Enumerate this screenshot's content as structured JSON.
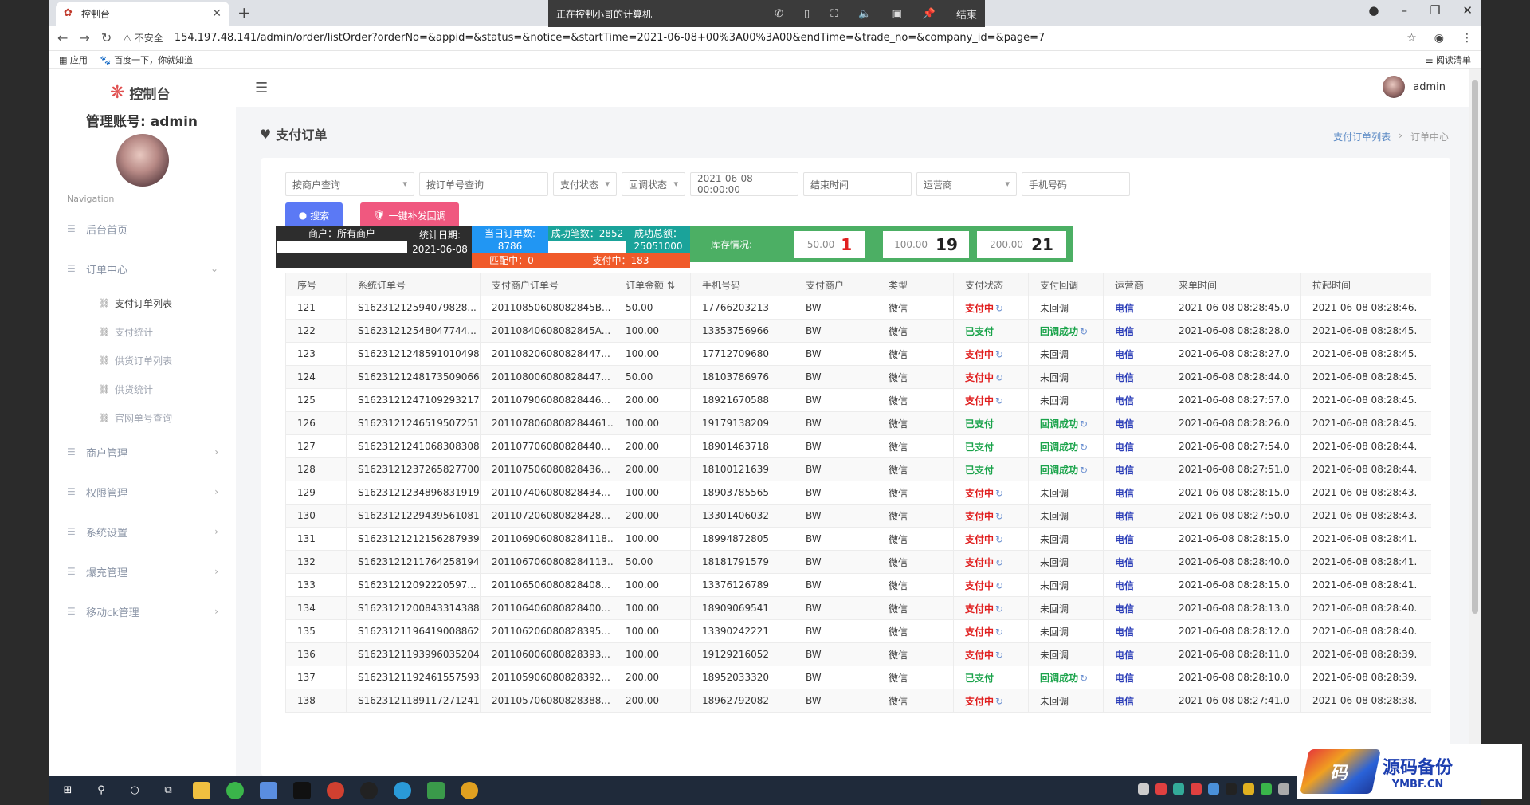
{
  "browser": {
    "tab_title": "控制台",
    "url": "154.197.48.141/admin/order/listOrder?orderNo=&appid=&status=&notice=&startTime=2021-06-08+00%3A00%3A00&endTime=&trade_no=&company_id=&page=7",
    "security_label": "不安全",
    "bookmarks": [
      "应用",
      "百度一下，你就知道"
    ],
    "reading_list": "阅读清单"
  },
  "remote_bar": {
    "title": "正在控制小哥的计算机",
    "end_label": "结束"
  },
  "sidebar": {
    "logo_text": "控制台",
    "account_label": "管理账号:  admin",
    "nav_title": "Navigation",
    "menu": [
      {
        "label": "后台首页",
        "has_arrow": false
      },
      {
        "label": "订单中心",
        "has_arrow": true,
        "expanded": true
      },
      {
        "label": "商户管理",
        "has_arrow": true
      },
      {
        "label": "权限管理",
        "has_arrow": true
      },
      {
        "label": "系统设置",
        "has_arrow": true
      },
      {
        "label": "爆充管理",
        "has_arrow": true
      },
      {
        "label": "移动ck管理",
        "has_arrow": true
      }
    ],
    "submenu": [
      "支付订单列表",
      "支付统计",
      "供货订单列表",
      "供货统计",
      "官网单号查询"
    ]
  },
  "header": {
    "user": "admin"
  },
  "page": {
    "title": "支付订单",
    "breadcrumb": [
      "支付订单列表",
      "订单中心"
    ]
  },
  "filters": {
    "merchant": "按商户查询",
    "order_no": "按订单号查询",
    "pay_status": "支付状态",
    "callback_status": "回调状态",
    "start_time": "2021-06-08 00:00:00",
    "end_time": "结束时间",
    "operator": "运营商",
    "phone": "手机号码"
  },
  "buttons": {
    "search": "搜索",
    "resend": "一键补发回调"
  },
  "stats": {
    "merchant": "商户：所有商户",
    "date_label": "统计日期:",
    "date_value": "2021-06-08",
    "today_orders_label": "当日订单数:",
    "today_orders": "8786",
    "success_count_label": "成功笔数：",
    "success_count": "2852",
    "success_total_label": "成功总额：",
    "success_total": "25051000",
    "matching": "匹配中：0",
    "paying": "支付中：183",
    "stock_label": "库存情况:",
    "stock": [
      {
        "amount": "50.00",
        "count": "1",
        "color": "#e02020"
      },
      {
        "amount": "100.00",
        "count": "19",
        "color": "#222222"
      },
      {
        "amount": "200.00",
        "count": "21",
        "color": "#222222"
      }
    ]
  },
  "table": {
    "headers": [
      "序号",
      "系统订单号",
      "支付商户订单号",
      "订单金额",
      "手机号码",
      "支付商户",
      "类型",
      "支付状态",
      "支付回调",
      "运营商",
      "来单时间",
      "拉起时间"
    ],
    "rows": [
      [
        "121",
        "S16231212594079828...",
        "20110850608082845B...",
        "50.00",
        "17766203213",
        "BW",
        "微信",
        "支付中",
        "未回调",
        "电信",
        "2021-06-08 08:28:45.0",
        "2021-06-08 08:28:46."
      ],
      [
        "122",
        "S16231212548047744...",
        "20110840608082845A...",
        "100.00",
        "13353756966",
        "BW",
        "微信",
        "已支付",
        "回调成功",
        "电信",
        "2021-06-08 08:28:28.0",
        "2021-06-08 08:28:45."
      ],
      [
        "123",
        "S16231212485910104​98",
        "20110820608082844​7...",
        "100.00",
        "17712709680",
        "BW",
        "微信",
        "支付中",
        "未回调",
        "电信",
        "2021-06-08 08:28:27.0",
        "2021-06-08 08:28:45."
      ],
      [
        "124",
        "S16231212481735090​66",
        "20110800608082844​7...",
        "50.00",
        "18103786976",
        "BW",
        "微信",
        "支付中",
        "未回调",
        "电信",
        "2021-06-08 08:28:44.0",
        "2021-06-08 08:28:45."
      ],
      [
        "125",
        "S16231212471092932​17",
        "20110790608082844​6...",
        "200.00",
        "18921670588",
        "BW",
        "微信",
        "支付中",
        "未回调",
        "电信",
        "2021-06-08 08:27:57.0",
        "2021-06-08 08:28:45."
      ],
      [
        "126",
        "S16231212465195072​51",
        "20110780608082844​61...",
        "100.00",
        "19179138209",
        "BW",
        "微信",
        "已支付",
        "回调成功",
        "电信",
        "2021-06-08 08:28:26.0",
        "2021-06-08 08:28:45."
      ],
      [
        "127",
        "S16231212410683083​08",
        "20110770608082844​0...",
        "200.00",
        "18901463718",
        "BW",
        "微信",
        "已支付",
        "回调成功",
        "电信",
        "2021-06-08 08:27:54.0",
        "2021-06-08 08:28:44."
      ],
      [
        "128",
        "S16231212372658277​00",
        "20110750608082843​6...",
        "200.00",
        "18100121639",
        "BW",
        "微信",
        "已支付",
        "回调成功",
        "电信",
        "2021-06-08 08:27:51.0",
        "2021-06-08 08:28:44."
      ],
      [
        "129",
        "S16231212348968319​19",
        "20110740608082843​4...",
        "100.00",
        "18903785565",
        "BW",
        "微信",
        "支付中",
        "未回调",
        "电信",
        "2021-06-08 08:28:15.0",
        "2021-06-08 08:28:43."
      ],
      [
        "130",
        "S16231212294395610​81",
        "20110720608082842​8...",
        "200.00",
        "13301406032",
        "BW",
        "微信",
        "支付中",
        "未回调",
        "电信",
        "2021-06-08 08:27:50.0",
        "2021-06-08 08:28:43."
      ],
      [
        "131",
        "S16231212121562879​39",
        "20110690608082841​18...",
        "100.00",
        "18994872805",
        "BW",
        "微信",
        "支付中",
        "未回调",
        "电信",
        "2021-06-08 08:28:15.0",
        "2021-06-08 08:28:41."
      ],
      [
        "132",
        "S16231212117642581​94",
        "20110670608082841​13...",
        "50.00",
        "18181791579",
        "BW",
        "微信",
        "支付中",
        "未回调",
        "电信",
        "2021-06-08 08:28:40.0",
        "2021-06-08 08:28:41."
      ],
      [
        "133",
        "S16231212092220597...",
        "20110650608082840​8...",
        "100.00",
        "13376126789",
        "BW",
        "微信",
        "支付中",
        "未回调",
        "电信",
        "2021-06-08 08:28:15.0",
        "2021-06-08 08:28:41."
      ],
      [
        "134",
        "S16231212008433143​88",
        "20110640608082840​0...",
        "100.00",
        "18909069541",
        "BW",
        "微信",
        "支付中",
        "未回调",
        "电信",
        "2021-06-08 08:28:13.0",
        "2021-06-08 08:28:40."
      ],
      [
        "135",
        "S16231211964190088​62",
        "20110620608082839​5...",
        "100.00",
        "13390242221",
        "BW",
        "微信",
        "支付中",
        "未回调",
        "电信",
        "2021-06-08 08:28:12.0",
        "2021-06-08 08:28:40."
      ],
      [
        "136",
        "S16231211939960352​04",
        "20110600608082839​3...",
        "100.00",
        "19129216052",
        "BW",
        "微信",
        "支付中",
        "未回调",
        "电信",
        "2021-06-08 08:28:11.0",
        "2021-06-08 08:28:39."
      ],
      [
        "137",
        "S16231211924615575​93",
        "20110590608082839​2...",
        "200.00",
        "18952033320",
        "BW",
        "微信",
        "已支付",
        "回调成功",
        "电信",
        "2021-06-08 08:28:10.0",
        "2021-06-08 08:28:39."
      ],
      [
        "138",
        "S16231211891172712​41",
        "20110570608082838​8...",
        "200.00",
        "18962792082",
        "BW",
        "微信",
        "支付中",
        "未回调",
        "电信",
        "2021-06-08 08:27:41.0",
        "2021-06-08 08:28:38."
      ]
    ]
  },
  "watermark": {
    "badge": "码",
    "title": "源码备份",
    "site": "YMBF.CN"
  }
}
